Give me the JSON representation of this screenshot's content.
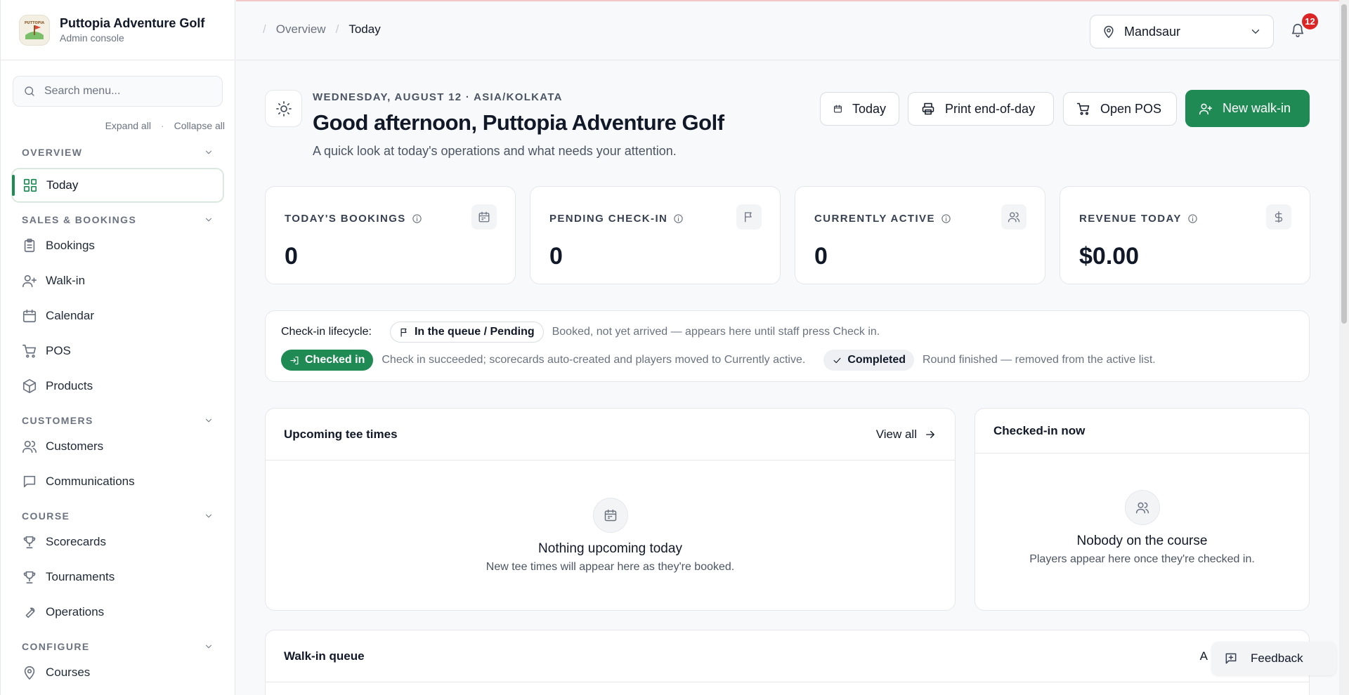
{
  "brand": {
    "title": "Puttopia Adventure Golf",
    "subtitle": "Admin console",
    "logo_text": "PUTTOPIA"
  },
  "sidebar": {
    "search_placeholder": "Search menu...",
    "expand_all": "Expand all",
    "collapse_all": "Collapse all",
    "sections": [
      {
        "title": "OVERVIEW",
        "items": [
          {
            "label": "Today",
            "icon": "grid-icon",
            "active": true
          }
        ]
      },
      {
        "title": "SALES & BOOKINGS",
        "items": [
          {
            "label": "Bookings",
            "icon": "clipboard-icon"
          },
          {
            "label": "Walk-in",
            "icon": "user-plus-icon"
          },
          {
            "label": "Calendar",
            "icon": "calendar-icon"
          },
          {
            "label": "POS",
            "icon": "cart-icon"
          },
          {
            "label": "Products",
            "icon": "box-icon"
          }
        ]
      },
      {
        "title": "CUSTOMERS",
        "items": [
          {
            "label": "Customers",
            "icon": "users-icon"
          },
          {
            "label": "Communications",
            "icon": "chat-icon"
          }
        ]
      },
      {
        "title": "COURSE",
        "items": [
          {
            "label": "Scorecards",
            "icon": "trophy-icon"
          },
          {
            "label": "Tournaments",
            "icon": "trophy-icon"
          },
          {
            "label": "Operations",
            "icon": "wrench-icon"
          }
        ]
      },
      {
        "title": "CONFIGURE",
        "items": [
          {
            "label": "Courses",
            "icon": "pin-icon"
          }
        ]
      }
    ]
  },
  "topbar": {
    "breadcrumb": [
      "Overview",
      "Today"
    ],
    "location": "Mandsaur",
    "notifications_count": "12"
  },
  "hero": {
    "dateline": "WEDNESDAY, AUGUST 12 · ASIA/KOLKATA",
    "greeting": "Good afternoon, Puttopia Adventure Golf",
    "subtitle": "A quick look at today's operations and what needs your attention.",
    "buttons": {
      "today": "Today",
      "print": "Print end-of-day",
      "pos": "Open POS",
      "walkin": "New walk-in"
    }
  },
  "stats": [
    {
      "label": "TODAY'S BOOKINGS",
      "value": "0",
      "icon": "calendar-icon"
    },
    {
      "label": "PENDING CHECK-IN",
      "value": "0",
      "icon": "flag-icon"
    },
    {
      "label": "CURRENTLY ACTIVE",
      "value": "0",
      "icon": "users-icon"
    },
    {
      "label": "REVENUE TODAY",
      "value": "$0.00",
      "icon": "dollar-icon"
    }
  ],
  "lifecycle": {
    "heading": "Check-in lifecycle:",
    "pending_chip": "In the queue / Pending",
    "pending_desc": "Booked, not yet arrived — appears here until staff press Check in.",
    "checked_chip": "Checked in",
    "checked_desc": "Check in succeeded; scorecards auto-created and players moved to Currently active.",
    "completed_chip": "Completed",
    "completed_desc": "Round finished — removed from the active list."
  },
  "upcoming": {
    "title": "Upcoming tee times",
    "view_all": "View all",
    "empty_title": "Nothing upcoming today",
    "empty_desc": "New tee times will appear here as they're booked."
  },
  "checked_in": {
    "title": "Checked-in now",
    "empty_title": "Nobody on the course",
    "empty_desc": "Players appear here once they're checked in."
  },
  "walkin_queue": {
    "title": "Walk-in queue",
    "action_partial": "A"
  },
  "feedback": "Feedback",
  "colors": {
    "brand_green": "#1f8a53",
    "badge_red": "#dc2626"
  }
}
